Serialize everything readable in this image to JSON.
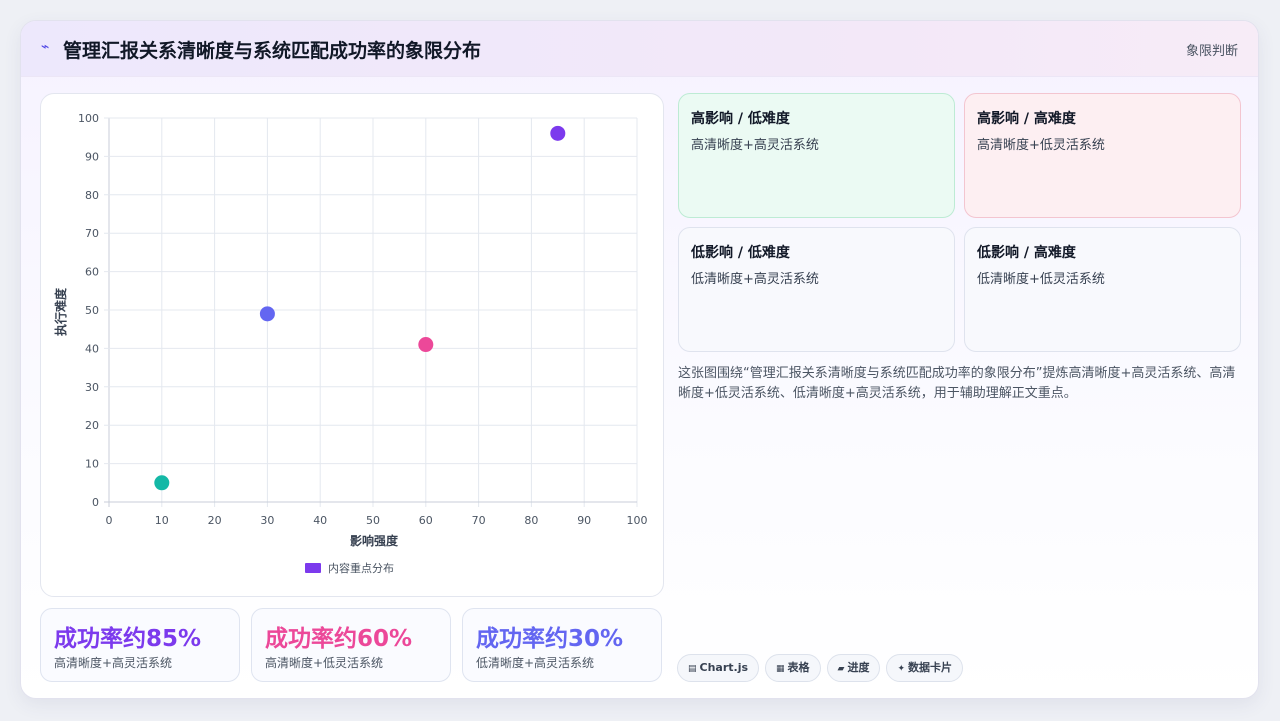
{
  "header": {
    "title": "管理汇报关系清晰度与系统匹配成功率的象限分布",
    "tag": "象限判断"
  },
  "chart_data": {
    "type": "scatter",
    "xlabel": "影响强度",
    "ylabel": "执行难度",
    "xlim": [
      0,
      100
    ],
    "ylim": [
      0,
      100
    ],
    "xticks": [
      0,
      10,
      20,
      30,
      40,
      50,
      60,
      70,
      80,
      90,
      100
    ],
    "yticks": [
      0,
      10,
      20,
      30,
      40,
      50,
      60,
      70,
      80,
      90,
      100
    ],
    "grid": true,
    "legend_position": "bottom",
    "series": [
      {
        "name": "内容重点分布",
        "legend_color": "#7c3aed",
        "points": [
          {
            "x": 10,
            "y": 5,
            "color": "#14b8a6"
          },
          {
            "x": 30,
            "y": 49,
            "color": "#6366f1"
          },
          {
            "x": 60,
            "y": 41,
            "color": "#ec4899"
          },
          {
            "x": 85,
            "y": 96,
            "color": "#7c3aed"
          }
        ]
      }
    ]
  },
  "kpis": [
    {
      "value": "成功率约85%",
      "label": "高清晰度+高灵活系统",
      "color": "#7c3aed"
    },
    {
      "value": "成功率约60%",
      "label": "高清晰度+低灵活系统",
      "color": "#ec4899"
    },
    {
      "value": "成功率约30%",
      "label": "低清晰度+高灵活系统",
      "color": "#6366f1"
    }
  ],
  "quadrants": [
    {
      "title": "高影响 / 低难度",
      "desc": "高清晰度+高灵活系统",
      "bg": "#ebfaf3",
      "border": "#bdebd4"
    },
    {
      "title": "高影响 / 高难度",
      "desc": "高清晰度+低灵活系统",
      "bg": "#fdeff2",
      "border": "#f3c5d0"
    },
    {
      "title": "低影响 / 低难度",
      "desc": "低清晰度+高灵活系统",
      "bg": "#f8f9fd",
      "border": "#dfe3ee"
    },
    {
      "title": "低影响 / 高难度",
      "desc": "低清晰度+低灵活系统",
      "bg": "#f8f9fd",
      "border": "#dfe3ee"
    }
  ],
  "description": "这张图围绕“管理汇报关系清晰度与系统匹配成功率的象限分布”提炼高清晰度+高灵活系统、高清晰度+低灵活系统、低清晰度+高灵活系统，用于辅助理解正文重点。",
  "chips": [
    {
      "icon": "▤",
      "label": "Chart.js"
    },
    {
      "icon": "▦",
      "label": "表格"
    },
    {
      "icon": "▰",
      "label": "进度"
    },
    {
      "icon": "✦",
      "label": "数据卡片"
    }
  ]
}
